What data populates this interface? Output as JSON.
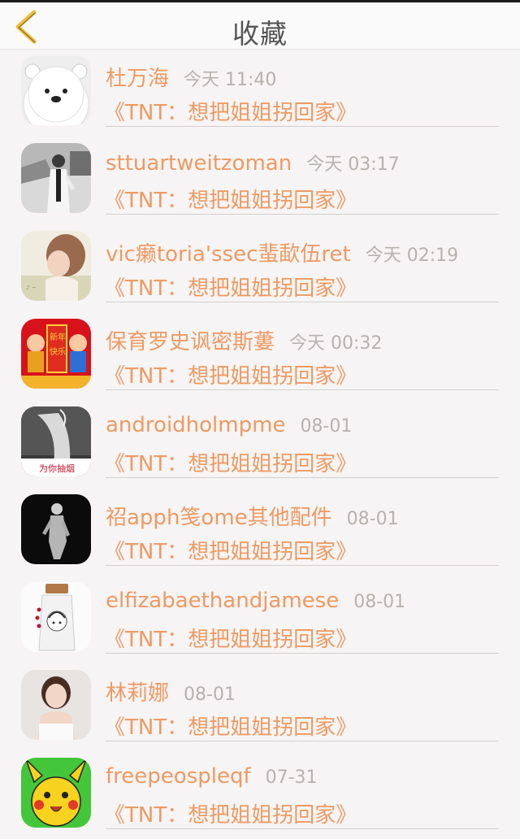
{
  "header": {
    "title": "收藏",
    "back_icon": "chevron-left-icon",
    "accent": "#f2bf34"
  },
  "items": [
    {
      "name": "杜万海",
      "time": "今天 11:40",
      "work": "《TNT：想把姐姐拐回家》",
      "avatar": "white-bear"
    },
    {
      "name": "sttuartweitzoman",
      "time": "今天 03:17",
      "work": "《TNT：想把姐姐拐回家》",
      "avatar": "man-photo-bw"
    },
    {
      "name": "vic癞toria'ssec蜚歃伍ret",
      "time": "今天 02:19",
      "work": "《TNT：想把姐姐拐回家》",
      "avatar": "girl-photo"
    },
    {
      "name": "保育罗史讽密斯蔞",
      "time": "今天 00:32",
      "work": "《TNT：想把姐姐拐回家》",
      "avatar": "new-year-kids"
    },
    {
      "name": "androidholmpme",
      "time": "08-01",
      "work": "《TNT：想把姐姐拐回家》",
      "avatar": "smoking-hand",
      "avatar_caption": "为你抽烟"
    },
    {
      "name": "祒apph笺ome其他配件",
      "time": "08-01",
      "work": "《TNT：想把姐姐拐回家》",
      "avatar": "silhouette-dark"
    },
    {
      "name": "elfizabaethandjamese",
      "time": "08-01",
      "work": "《TNT：想把姐姐拐回家》",
      "avatar": "bottle-girl"
    },
    {
      "name": "林莉娜",
      "time": "08-01",
      "work": "《TNT：想把姐姐拐回家》",
      "avatar": "woman-portrait"
    },
    {
      "name": "freepeospleqf",
      "time": "07-31",
      "work": "《TNT：想把姐姐拐回家》",
      "avatar": "pikachu"
    }
  ],
  "colors": {
    "name_text": "#ee9a63",
    "time_text": "#b7b2b0",
    "divider": "#d3cfcf"
  }
}
